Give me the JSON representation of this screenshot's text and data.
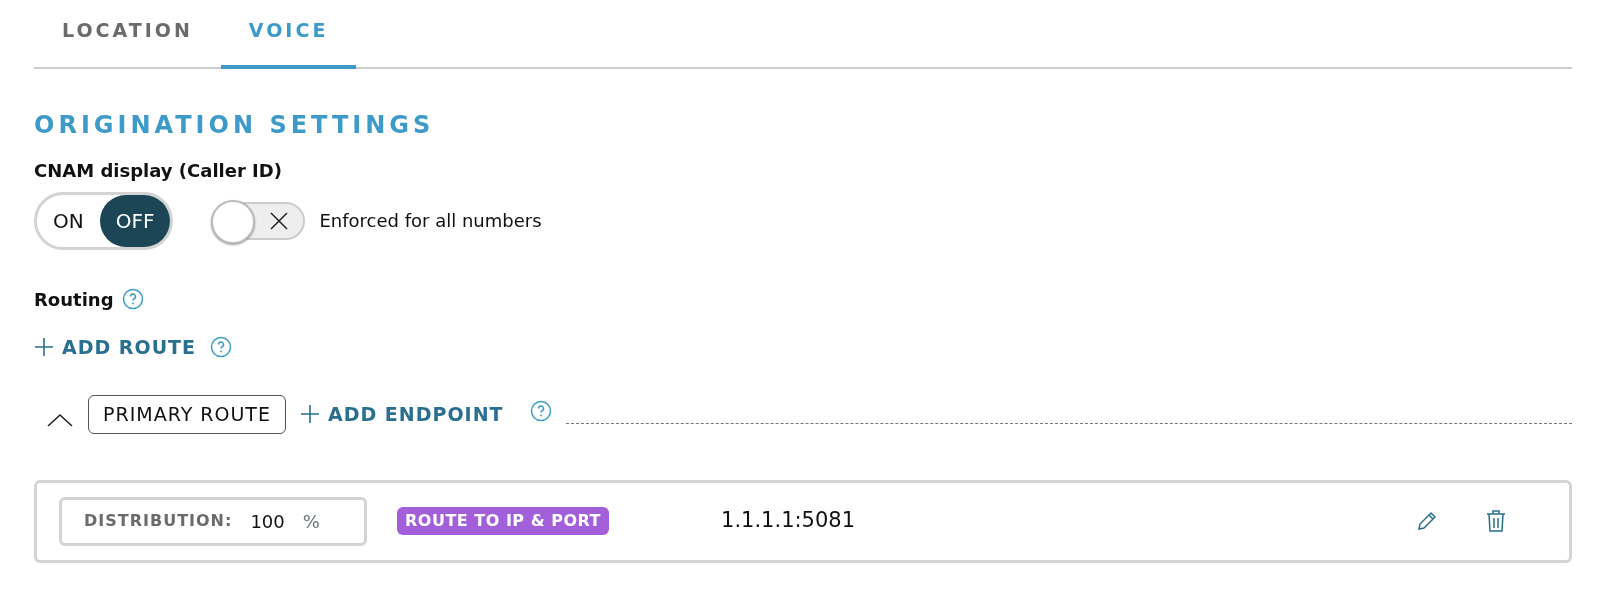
{
  "tabs": [
    {
      "label": "LOCATION",
      "selected": false
    },
    {
      "label": "VOICE",
      "selected": true
    }
  ],
  "section_title": "ORIGINATION SETTINGS",
  "cnam": {
    "label": "CNAM display (Caller ID)",
    "options": [
      {
        "label": "ON",
        "selected": false
      },
      {
        "label": "OFF",
        "selected": true
      }
    ],
    "enforce_switch": {
      "on": false,
      "label": "Enforced for all numbers"
    }
  },
  "routing": {
    "label": "Routing",
    "add_route": "ADD ROUTE",
    "routes": [
      {
        "name": "PRIMARY ROUTE",
        "expanded": true,
        "add_endpoint": "ADD ENDPOINT",
        "endpoints": [
          {
            "distribution_label": "DISTRIBUTION:",
            "distribution": "100",
            "unit": "%",
            "type": "ROUTE TO IP & PORT",
            "address": "1.1.1.1:5081"
          }
        ]
      }
    ]
  }
}
